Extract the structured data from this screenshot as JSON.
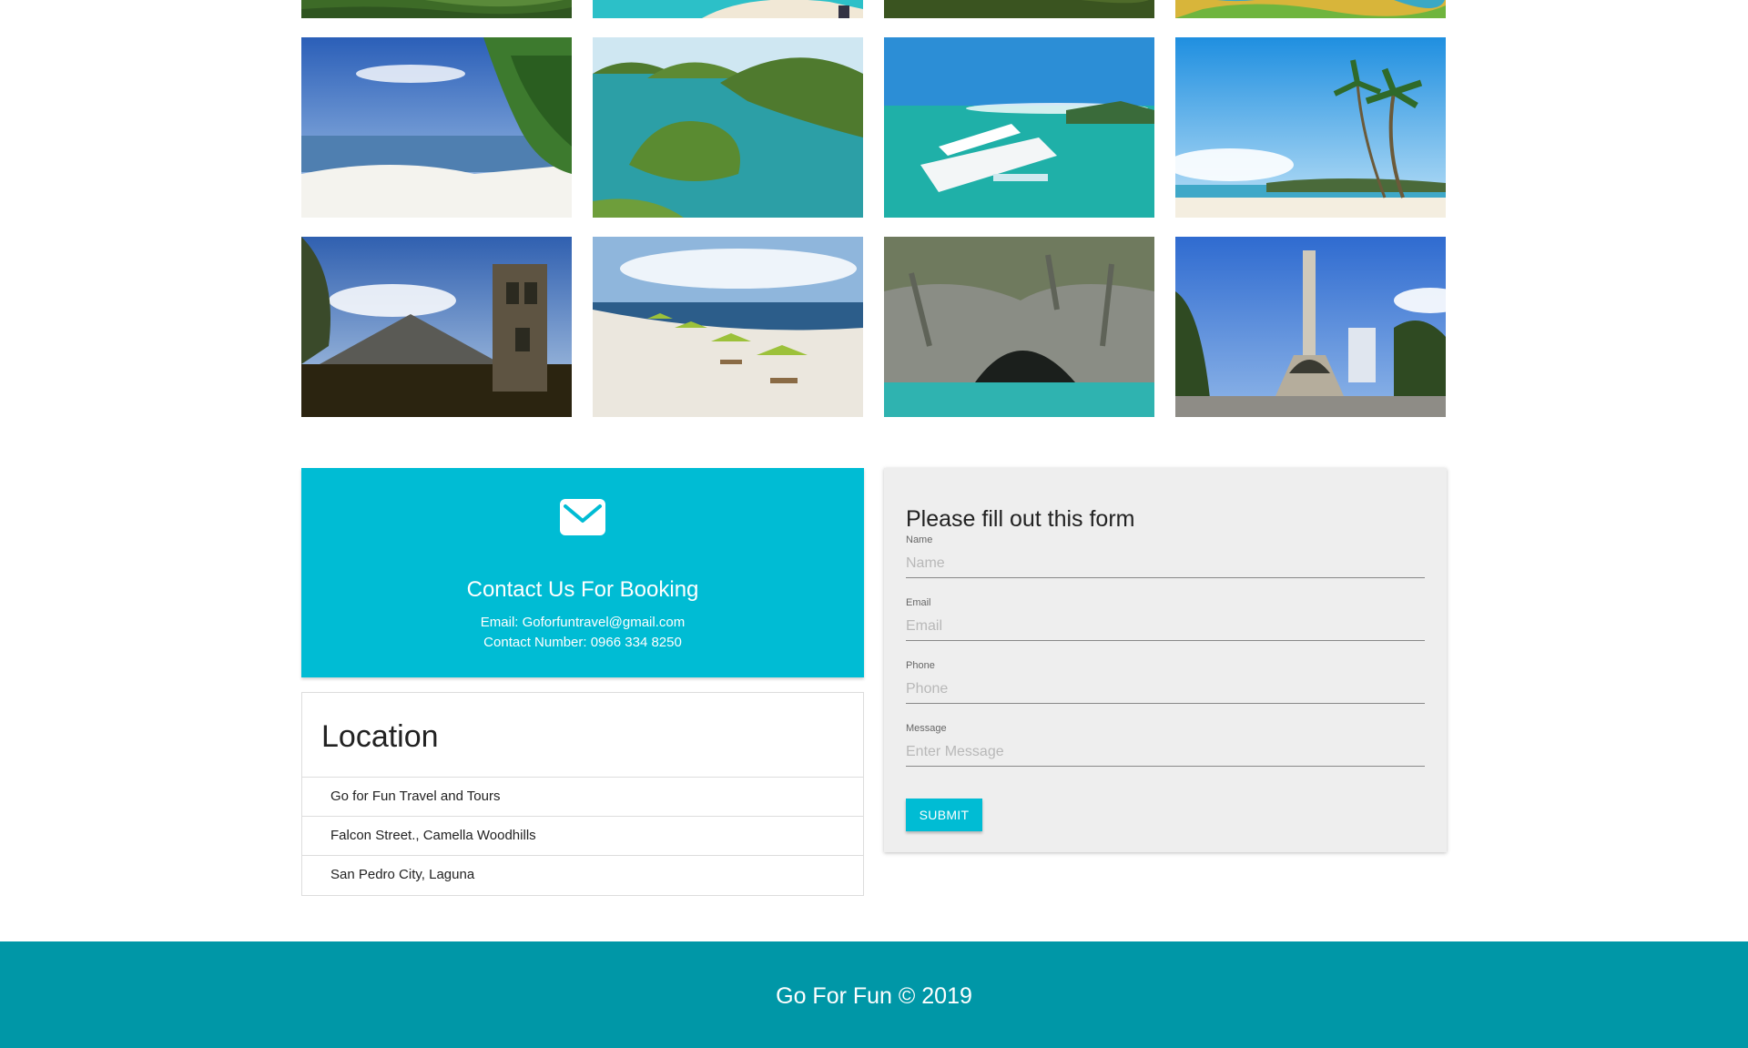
{
  "colors": {
    "accent": "#00bcd4",
    "footer": "#0097a7",
    "form_bg": "#eeeeee"
  },
  "gallery": {
    "rows": [
      [
        "rice-terraces",
        "turquoise-beach",
        "green-hills",
        "coral-reef"
      ],
      [
        "white-sand-beach",
        "hundred-islands",
        "outrigger-boat",
        "palm-beach"
      ],
      [
        "cagsawa-ruins",
        "beach-umbrellas",
        "underground-river",
        "rizal-monument"
      ]
    ]
  },
  "contact": {
    "icon": "envelope-icon",
    "title": "Contact Us For Booking",
    "email_line": "Email: Goforfuntravel@gmail.com",
    "phone_line": "Contact Number: 0966 334 8250"
  },
  "location": {
    "title": "Location",
    "items": [
      "Go for Fun Travel and Tours",
      "Falcon Street., Camella Woodhills",
      "San Pedro City, Laguna"
    ]
  },
  "form": {
    "title": "Please fill out this form",
    "fields": {
      "name": {
        "label": "Name",
        "placeholder": "Name",
        "value": ""
      },
      "email": {
        "label": "Email",
        "placeholder": "Email",
        "value": ""
      },
      "phone": {
        "label": "Phone",
        "placeholder": "Phone",
        "value": ""
      },
      "message": {
        "label": "Message",
        "placeholder": "Enter Message",
        "value": ""
      }
    },
    "submit_label": "SUBMIT"
  },
  "footer": {
    "text": "Go For Fun © 2019"
  }
}
